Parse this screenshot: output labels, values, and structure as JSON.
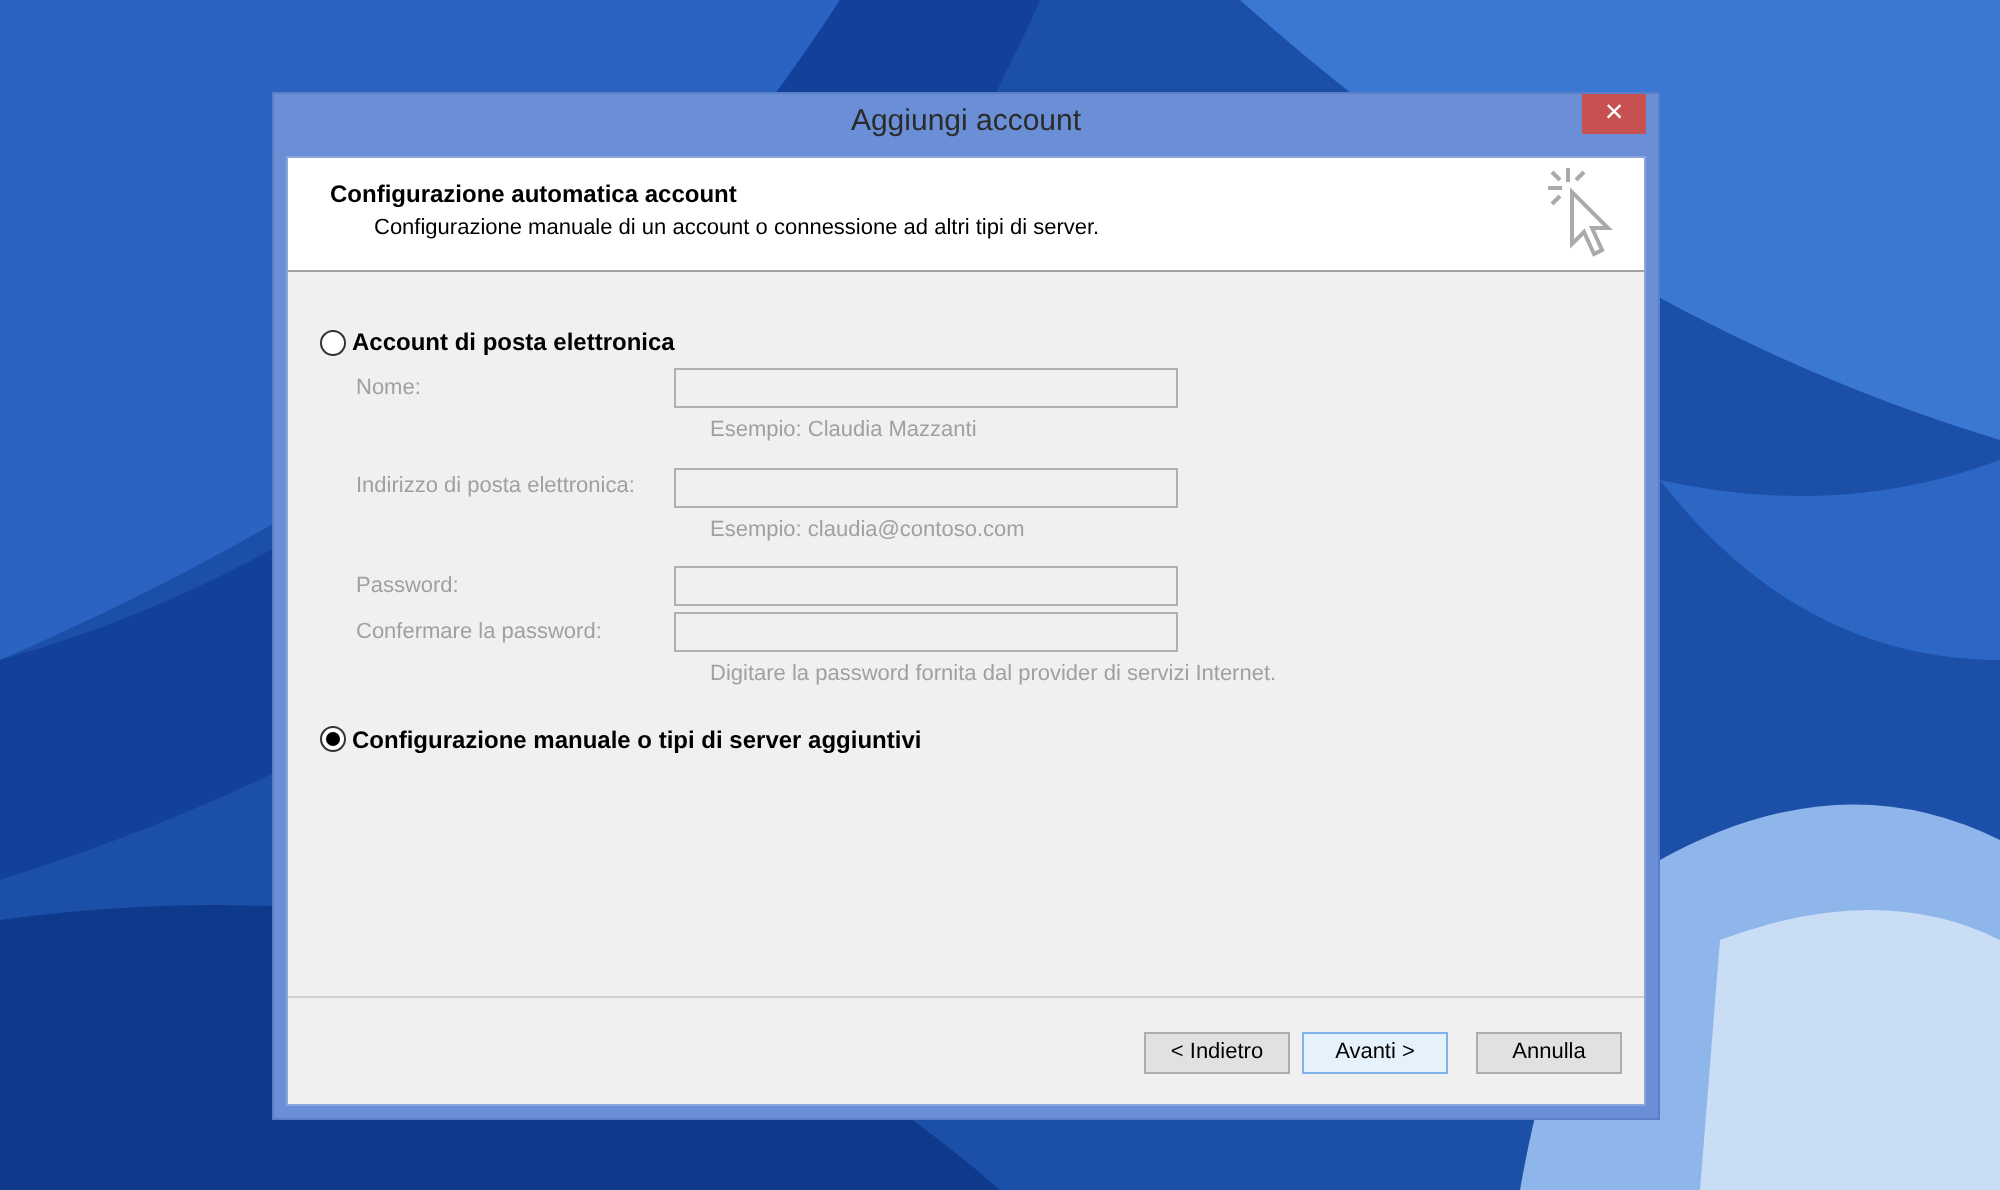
{
  "window": {
    "title": "Aggiungi account",
    "close": "×"
  },
  "header": {
    "title": "Configurazione automatica account",
    "subtitle": "Configurazione manuale di un account o connessione ad altri tipi di server."
  },
  "options": [
    {
      "label": "Account di posta elettronica",
      "selected": false,
      "fields": [
        {
          "label": "Nome:",
          "disabled": true,
          "hint": "Esempio: Claudia Mazzanti"
        },
        {
          "label": "Indirizzo di posta elettronica:",
          "disabled": true,
          "hint": "Esempio: claudia@contoso.com"
        },
        {
          "label": "Password:",
          "disabled": true
        },
        {
          "label": "Confermare la password:",
          "disabled": true,
          "hint": "Digitare la password fornita dal provider di servizi Internet."
        }
      ]
    },
    {
      "label": "Configurazione manuale o tipi di server aggiuntivi",
      "selected": true
    }
  ],
  "buttons": [
    {
      "label": "< Indietro",
      "hovered": false
    },
    {
      "label": "Avanti >",
      "hovered": true
    },
    {
      "label": "Annulla",
      "hovered": false
    }
  ]
}
